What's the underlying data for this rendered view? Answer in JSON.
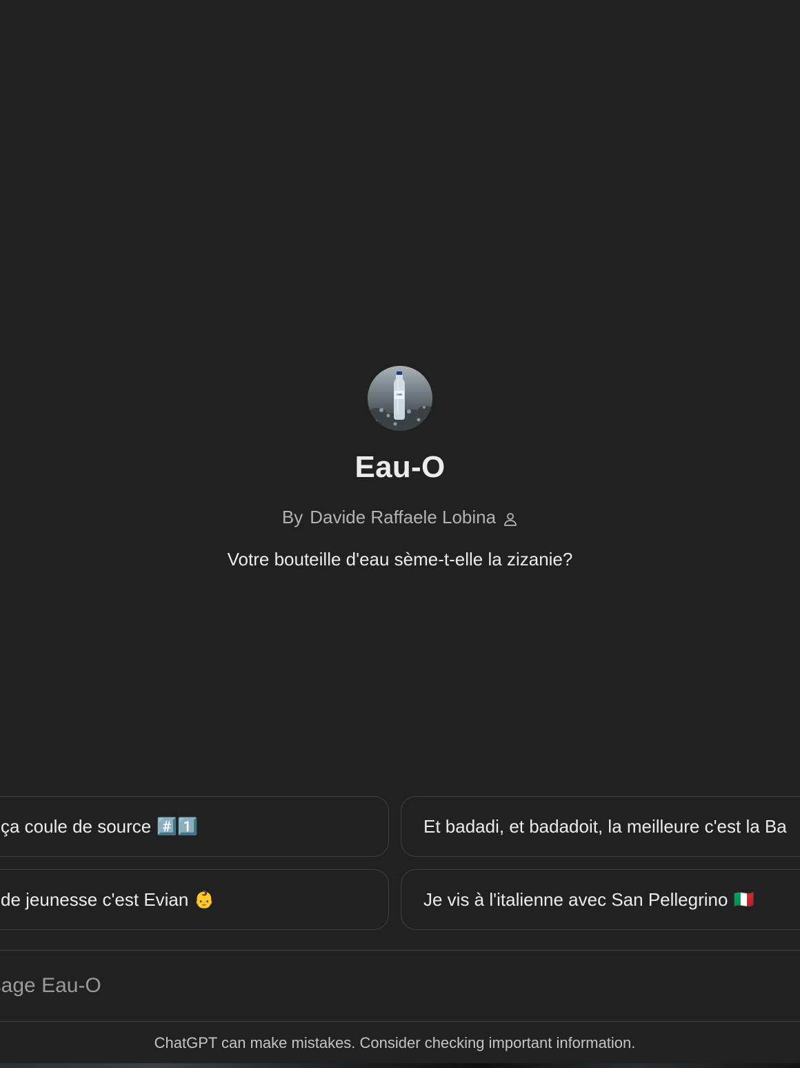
{
  "gpt": {
    "name": "Eau-O",
    "author_prefix": "By",
    "author_name": "Davide Raffaele Lobina",
    "description": "Votre bouteille d'eau sème-t-elle la zizanie?",
    "avatar_icon": "water-bottle-avatar",
    "author_icon": "person-icon"
  },
  "starters": [
    {
      "label": "ça coule de source",
      "emoji": "#️⃣1️⃣"
    },
    {
      "label": "Et badadi, et badadoit, la meilleure c'est la Ba",
      "emoji": ""
    },
    {
      "label": "de jeunesse c'est Evian",
      "emoji": "👶"
    },
    {
      "label": "Je vis à l'italienne avec San Pellegrino",
      "emoji": "🇮🇹"
    }
  ],
  "composer": {
    "placeholder": "Message Eau-O"
  },
  "footer": {
    "disclaimer": "ChatGPT can make mistakes. Consider checking important information."
  }
}
